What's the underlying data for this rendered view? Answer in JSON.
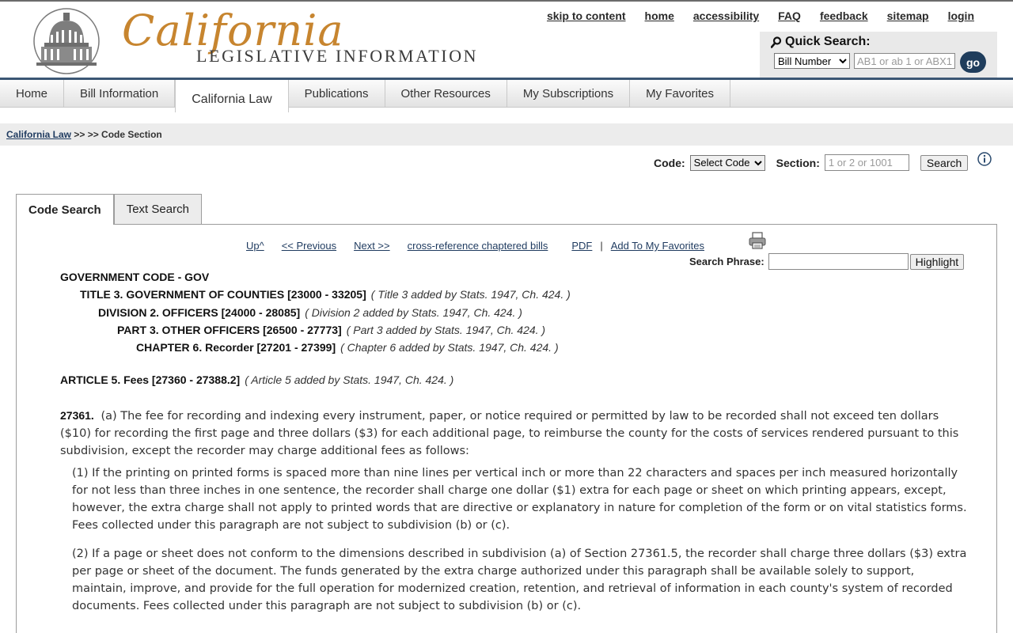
{
  "brand": {
    "script": "California",
    "subtitle": "LEGISLATIVE INFORMATION"
  },
  "utility_links": [
    "skip to content",
    "home",
    "accessibility",
    "FAQ",
    "feedback",
    "sitemap",
    "login"
  ],
  "quick_search": {
    "title": "Quick Search:",
    "select_value": "Bill Number",
    "input_placeholder": "AB1 or ab 1 or ABX1",
    "go_label": "go"
  },
  "nav": {
    "tabs": [
      "Home",
      "Bill Information",
      "California Law",
      "Publications",
      "Other Resources",
      "My Subscriptions",
      "My Favorites"
    ],
    "active": "California Law"
  },
  "breadcrumb": {
    "link": "California Law",
    "rest": " >> >> Code Section"
  },
  "code_lookup": {
    "code_label": "Code:",
    "code_value": "Select Code",
    "section_label": "Section:",
    "section_placeholder": "1 or 2 or 1001",
    "search_label": "Search"
  },
  "search_tabs": [
    "Code Search",
    "Text Search"
  ],
  "toolbar": {
    "up": "Up^",
    "previous": "<< Previous",
    "next": "Next >>",
    "crossref": "cross-reference chaptered bills",
    "pdf": "PDF",
    "separator": "|",
    "favorites": "Add To My Favorites"
  },
  "phrase": {
    "label": "Search Phrase:",
    "button": "Highlight"
  },
  "hierarchy": [
    {
      "title": "GOVERNMENT CODE - GOV",
      "note": ""
    },
    {
      "title": "TITLE 3. GOVERNMENT OF COUNTIES [23000 - 33205]",
      "note": "( Title 3 added by Stats. 1947, Ch. 424. )"
    },
    {
      "title": "DIVISION 2. OFFICERS [24000 - 28085]",
      "note": "( Division 2 added by Stats. 1947, Ch. 424. )"
    },
    {
      "title": "PART 3. OTHER OFFICERS [26500 - 27773]",
      "note": "( Part 3 added by Stats. 1947, Ch. 424. )"
    },
    {
      "title": "CHAPTER 6. Recorder [27201 - 27399]",
      "note": "( Chapter 6 added by Stats. 1947, Ch. 424. )"
    }
  ],
  "article": {
    "title": "ARTICLE 5. Fees [27360 - 27388.2]",
    "note": "( Article 5 added by Stats. 1947, Ch. 424. )"
  },
  "section": {
    "number": "27361.",
    "intro": "(a) The fee for recording and indexing every instrument, paper, or notice required or permitted by law to be recorded shall not exceed ten dollars ($10) for recording the first page and three dollars ($3) for each additional page, to reimburse the county for the costs of services rendered pursuant to this subdivision, except the recorder may charge additional fees as follows:",
    "para1": "(1) If the printing on printed forms is spaced more than nine lines per vertical inch or more than 22 characters and spaces per inch measured horizontally for not less than three inches in one sentence, the recorder shall charge one dollar ($1) extra for each page or sheet on which printing appears, except, however, the extra charge shall not apply to printed words that are directive or explanatory in nature for completion of the form or on vital statistics forms. Fees collected under this paragraph are not subject to subdivision (b) or (c).",
    "para2": "(2) If a page or sheet does not conform to the dimensions described in subdivision (a) of Section 27361.5, the recorder shall charge three dollars ($3) extra per page or sheet of the document. The funds generated by the extra charge authorized under this paragraph shall be available solely to support, maintain, improve, and provide for the full operation for modernized creation, retention, and retrieval of information in each county's system of recorded documents. Fees collected under this paragraph are not subject to subdivision (b) or (c)."
  }
}
